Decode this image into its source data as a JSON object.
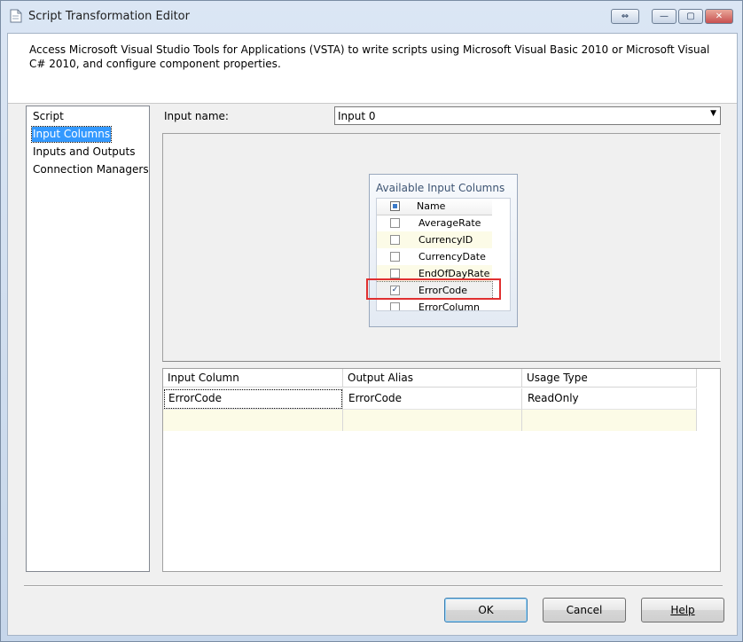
{
  "window": {
    "title": "Script Transformation Editor",
    "controls": {
      "restore": "⇔",
      "minimize": "—",
      "maximize": "▢",
      "close": "✕"
    }
  },
  "header": {
    "description": "Access Microsoft Visual Studio Tools for Applications (VSTA) to write scripts using Microsoft Visual Basic 2010 or Microsoft Visual C# 2010, and configure component properties."
  },
  "nav": {
    "items": [
      {
        "label": "Script",
        "selected": false
      },
      {
        "label": "Input Columns",
        "selected": true
      },
      {
        "label": "Inputs and Outputs",
        "selected": false
      },
      {
        "label": "Connection Managers",
        "selected": false
      }
    ]
  },
  "input": {
    "label": "Input name:",
    "selected": "Input 0"
  },
  "available": {
    "title": "Available Input Columns",
    "header_name": "Name",
    "columns": [
      {
        "name": "AverageRate",
        "checked": false
      },
      {
        "name": "CurrencyID",
        "checked": false
      },
      {
        "name": "CurrencyDate",
        "checked": false
      },
      {
        "name": "EndOfDayRate",
        "checked": false
      },
      {
        "name": "ErrorCode",
        "checked": true
      },
      {
        "name": "ErrorColumn",
        "checked": false
      }
    ]
  },
  "mapping": {
    "headers": [
      "Input Column",
      "Output Alias",
      "Usage Type"
    ],
    "rows": [
      [
        "ErrorCode",
        "ErrorCode",
        "ReadOnly"
      ]
    ]
  },
  "buttons": {
    "ok": "OK",
    "cancel": "Cancel",
    "help": "Help"
  },
  "colors": {
    "selection": "#3399ff",
    "highlight_box": "#e03030",
    "alt_row": "#fcfbe7"
  }
}
